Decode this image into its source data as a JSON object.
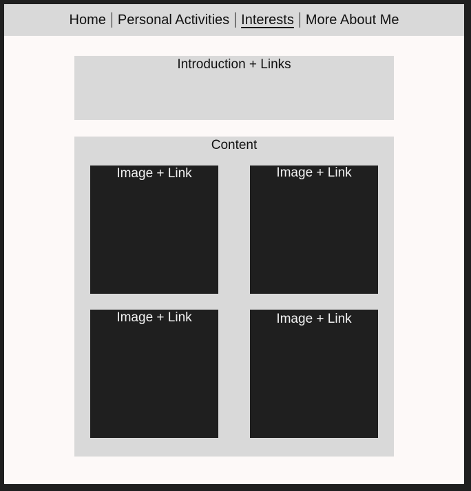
{
  "nav": {
    "items": [
      {
        "label": "Home"
      },
      {
        "label": "Personal Activities"
      },
      {
        "label": "Interests",
        "active": true
      },
      {
        "label": "More About Me"
      }
    ]
  },
  "intro": {
    "label": "Introduction + Links"
  },
  "content": {
    "title": "Content",
    "cards": [
      {
        "label": "Image + Link"
      },
      {
        "label": "Image + Link"
      },
      {
        "label": "Image + Link"
      },
      {
        "label": "Image + Link"
      }
    ]
  },
  "colors": {
    "outer_border": "#1f1f1f",
    "page_background": "#fdf9f8",
    "panel": "#d9d9d9",
    "card": "#1f1f1f",
    "card_text": "#f2f2f2"
  }
}
